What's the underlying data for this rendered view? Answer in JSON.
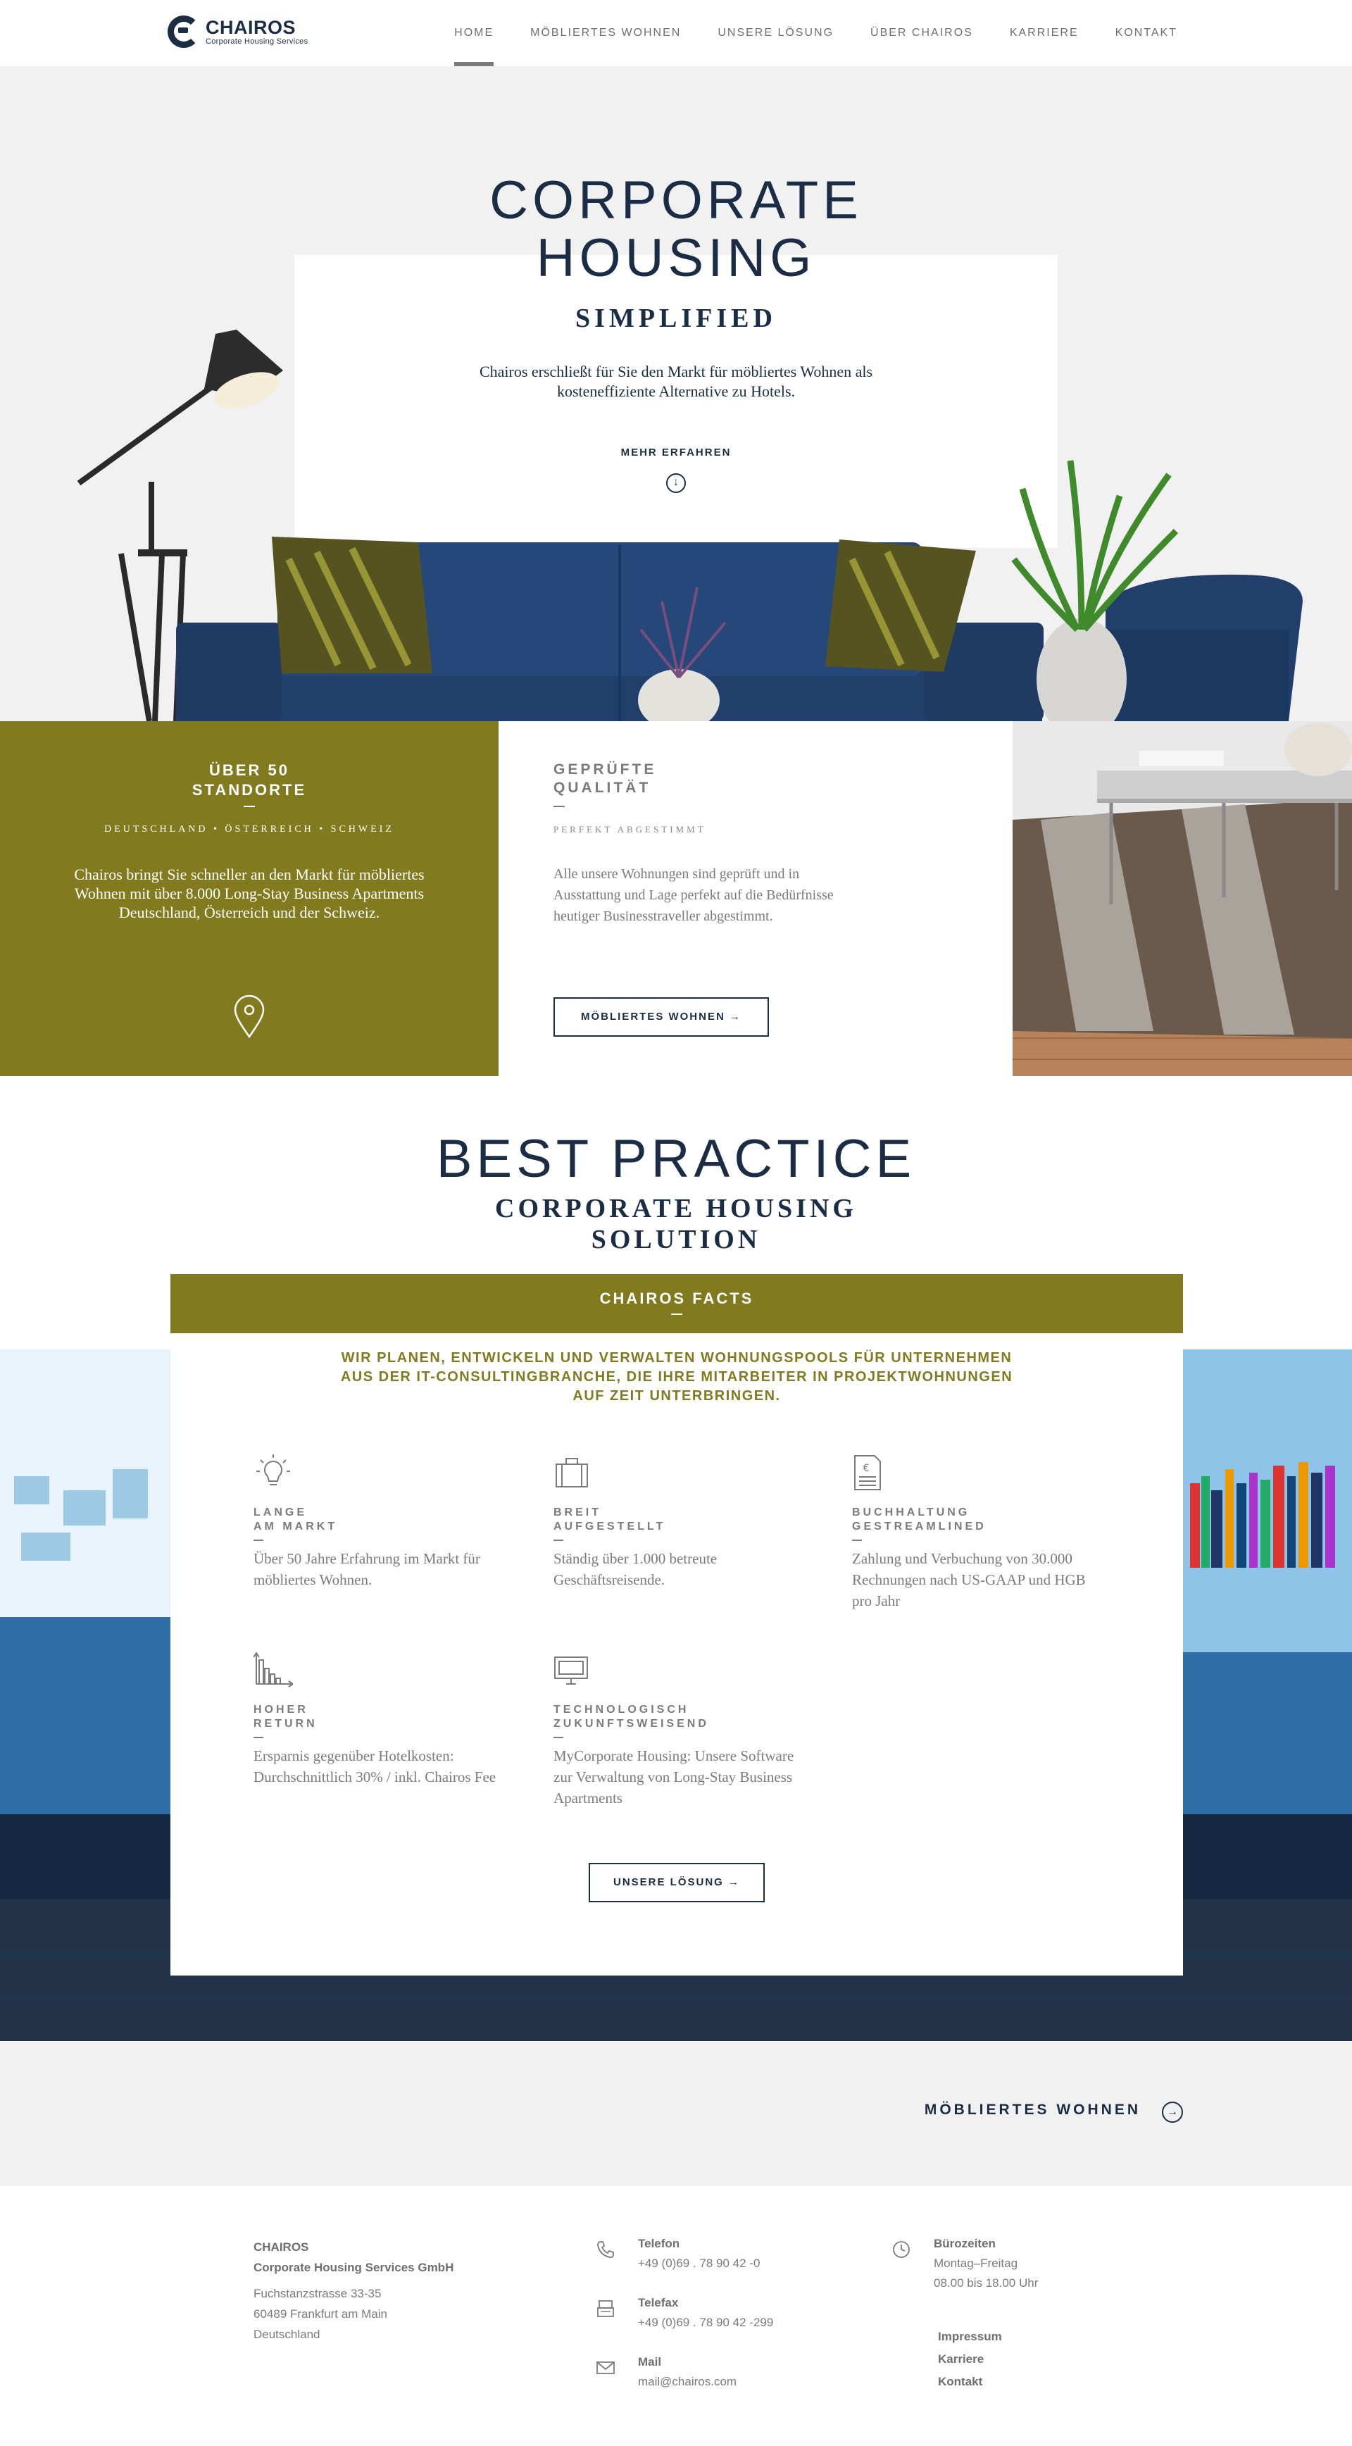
{
  "header": {
    "logo_name": "CHAIROS",
    "logo_sub": "Corporate Housing Services",
    "nav": [
      "HOME",
      "MÖBLIERTES WOHNEN",
      "UNSERE LÖSUNG",
      "ÜBER CHAIROS",
      "KARRIERE",
      "KONTAKT"
    ],
    "active_nav": "HOME"
  },
  "hero": {
    "title_line1": "CORPORATE",
    "title_line2": "HOUSING",
    "subtitle": "SIMPLIFIED",
    "text": "Chairos erschließt für Sie den Markt für möbliertes Wohnen als kosteneffiziente Alternative zu Hotels.",
    "cta": "MEHR ERFAHREN"
  },
  "features": {
    "locations": {
      "title_line1": "ÜBER 50",
      "title_line2": "STANDORTE",
      "tag": "DEUTSCHLAND • ÖSTERREICH • SCHWEIZ",
      "text": "Chairos bringt Sie schneller an den Markt für möbliertes Wohnen mit über 8.000 Long-Stay Business Apartments Deutschland, Österreich und der Schweiz."
    },
    "quality": {
      "title_line1": "GEPRÜFTE",
      "title_line2": "QUALITÄT",
      "tag": "PERFEKT ABGESTIMMT",
      "text": "Alle unsere Wohnungen sind geprüft und in Ausstattung und Lage perfekt auf die Bedürfnisse heutiger Businesstraveller abgestimmt.",
      "button": "MÖBLIERTES WOHNEN"
    }
  },
  "best_practice": {
    "title": "BEST PRACTICE",
    "sub_line1": "CORPORATE HOUSING",
    "sub_line2": "SOLUTION",
    "facts_title": "CHAIROS FACTS",
    "lead_line1": "WIR PLANEN, ENTWICKELN UND VERWALTEN WOHNUNGSPOOLS FÜR UNTERNEHMEN",
    "lead_line2": "AUS DER IT-CONSULTINGBRANCHE, DIE IHRE MITARBEITER IN PROJEKTWOHNUNGEN",
    "lead_line3": "AUF ZEIT UNTERBRINGEN.",
    "facts": [
      {
        "icon": "lightbulb-icon",
        "title_line1": "LANGE",
        "title_line2": "AM MARKT",
        "text": "Über 50 Jahre Erfahrung im Markt für möbliertes Wohnen."
      },
      {
        "icon": "briefcase-icon",
        "title_line1": "BREIT",
        "title_line2": "AUFGESTELLT",
        "text": "Ständig über 1.000 betreute Geschäftsreisende."
      },
      {
        "icon": "invoice-icon",
        "title_line1": "BUCHHALTUNG",
        "title_line2": "GESTREAMLINED",
        "text": "Zahlung und Verbuchung von 30.000 Rechnungen nach US-GAAP und HGB pro Jahr"
      },
      {
        "icon": "bar-chart-icon",
        "title_line1": "HOHER",
        "title_line2": "RETURN",
        "text": "Ersparnis gegenüber Hotelkosten: Durchschnittlich 30% / inkl. Chairos Fee"
      },
      {
        "icon": "monitor-icon",
        "title_line1": "TECHNOLOGISCH",
        "title_line2": "ZUKUNFTSWEISEND",
        "text": "MyCorporate Housing: Unsere Software zur Verwaltung von Long-Stay Business Apartments"
      }
    ],
    "button": "UNSERE LÖSUNG"
  },
  "cta": {
    "label": "MÖBLIERTES WOHNEN"
  },
  "footer": {
    "company_line1": "CHAIROS",
    "company_line2": "Corporate Housing Services GmbH",
    "street": "Fuchstanzstrasse 33-35",
    "city": "60489 Frankfurt am Main",
    "country": "Deutschland",
    "phone_label": "Telefon",
    "phone": "+49 (0)69 . 78 90 42 -0",
    "fax_label": "Telefax",
    "fax": "+49 (0)69 . 78 90 42 -299",
    "mail_label": "Mail",
    "mail": "mail@chairos.com",
    "hours_label": "Bürozeiten",
    "hours_days": "Montag–Freitag",
    "hours_time": "08.00 bis 18.00 Uhr",
    "links": [
      "Impressum",
      "Karriere",
      "Kontakt"
    ]
  },
  "colors": {
    "navy": "#1b2d45",
    "olive": "#817a1f",
    "light_gray": "#f1f1f1",
    "text_gray": "#7b7b7b"
  }
}
